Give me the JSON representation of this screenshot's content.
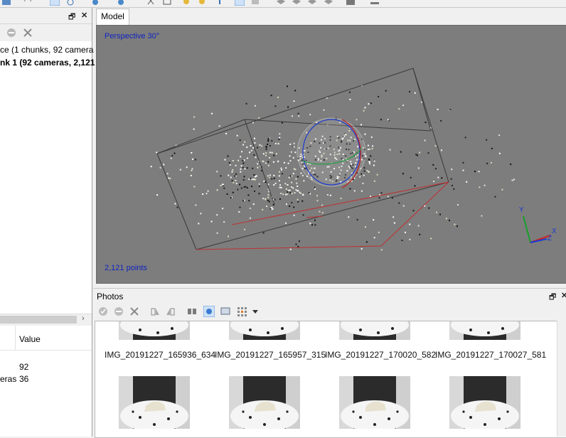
{
  "model_tab": {
    "label": "Model"
  },
  "viewport": {
    "projection_label": "Perspective 30°",
    "points_label": "2,121 points",
    "axis_x": "X",
    "axis_y": "Y",
    "axis_z": "Z"
  },
  "workspace_tree": {
    "items": [
      {
        "label": "ce (1 chunks, 92 camera",
        "bold": false
      },
      {
        "label": "nk 1 (92 cameras, 2,121",
        "bold": true
      }
    ]
  },
  "properties": {
    "header_value": "Value",
    "rows": [
      {
        "name": "",
        "value": "92"
      },
      {
        "name": "eras",
        "value": "36"
      }
    ]
  },
  "photos": {
    "title": "Photos",
    "row1": [
      "IMG_20191227_165936_634",
      "IMG_20191227_165957_315",
      "IMG_20191227_170020_582",
      "IMG_20191227_170027_581"
    ]
  },
  "colors": {
    "viewport_bg": "#7d7d7d",
    "overlay_text": "#1024c0",
    "bbox_line": "#3a3a3a",
    "floor_line": "#c03030"
  }
}
